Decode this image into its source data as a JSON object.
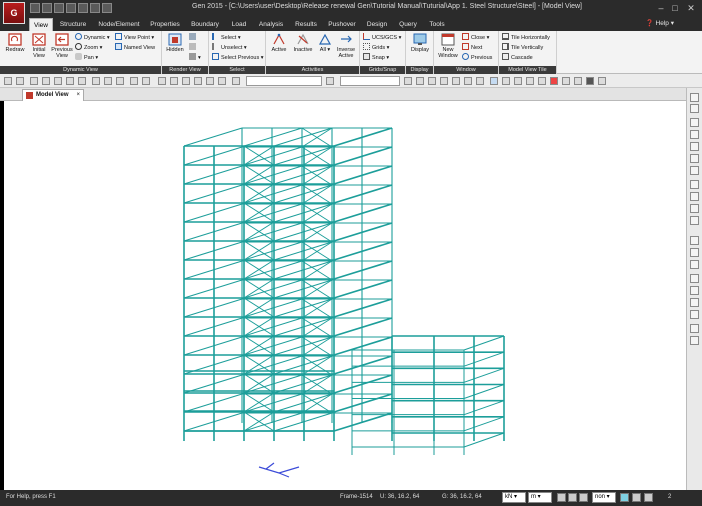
{
  "app": {
    "logo": "G",
    "title": "Gen 2015 - [C:\\Users\\user\\Desktop\\Release renewal Gen\\Tutorial Manual\\Tuturial\\App 1. Steel Structure\\Steel] - [Model View]"
  },
  "tabs": [
    "View",
    "Structure",
    "Node/Element",
    "Properties",
    "Boundary",
    "Load",
    "Analysis",
    "Results",
    "Pushover",
    "Design",
    "Query",
    "Tools"
  ],
  "help_label": "Help",
  "ribbon": {
    "dynamic_view": {
      "label": "Dynamic View",
      "redraw": "Redraw",
      "initial": "Initial View",
      "previous": "Previous View",
      "dynamic": "Dynamic",
      "zoom": "Zoom",
      "pan": "Pan",
      "view_point": "View Point",
      "named_view": "Named View"
    },
    "render_view": {
      "label": "Render View",
      "hidden": "Hidden"
    },
    "select": {
      "label": "Select",
      "select": "Select",
      "unselect": "Unselect",
      "select_previous": "Select Previous"
    },
    "activities": {
      "label": "Activities",
      "active": "Active",
      "inactive": "Inactive",
      "all": "All",
      "inverse": "Inverse Active"
    },
    "grids_snap": {
      "label": "Grids/Snap",
      "ucs": "UCS/GCS",
      "grids": "Grids",
      "snap": "Snap"
    },
    "display": {
      "label": "Display",
      "display": "Display"
    },
    "window": {
      "label": "Window",
      "new_window": "New Window",
      "close": "Close",
      "next": "Next",
      "previous": "Previous"
    },
    "model_view_tile": {
      "label": "Model View Tile",
      "horizontal": "Tile Horizontally",
      "vertical": "Tile Vertically",
      "cascade": "Cascade"
    }
  },
  "document_tab": {
    "label": "Model View",
    "close": "×"
  },
  "status": {
    "help": "For Help, press F1",
    "frame": "Frame-1514",
    "u": "U: 36, 16.2, 64",
    "g": "G: 36, 16.2, 64",
    "force_unit": "kN",
    "length_unit": "m",
    "option": "non",
    "page": "2"
  },
  "colors": {
    "structure": "#1c9e9a",
    "ribbon_dark": "#2b2b2b",
    "canvas": "#ffffff"
  }
}
